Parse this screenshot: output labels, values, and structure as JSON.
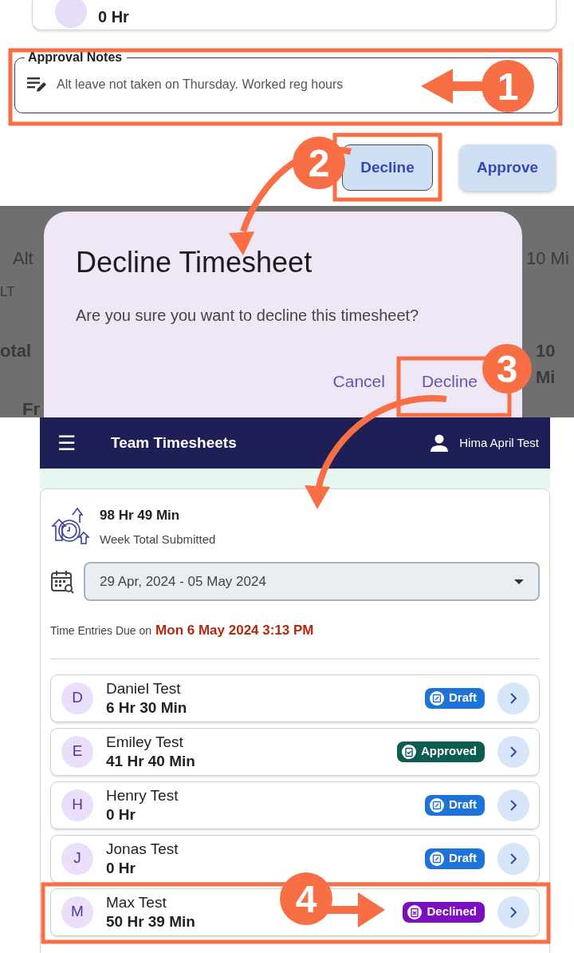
{
  "previous_card": {
    "hours": "0 Hr"
  },
  "approval_notes": {
    "label": "Approval Notes",
    "value": "Alt leave not taken on Thursday. Worked reg hours"
  },
  "review_buttons": [
    {
      "label": "Decline",
      "kind": "outlined"
    },
    {
      "label": "Approve",
      "kind": "raised"
    }
  ],
  "background_texts": [
    "Alt",
    "10 Mi",
    "LT",
    "otal",
    "10 Mi",
    "Fr"
  ],
  "dialog": {
    "title": "Decline Timesheet",
    "message": "Are you sure you want to decline this timesheet?",
    "buttons": [
      "Cancel",
      "Decline"
    ]
  },
  "app_bar": {
    "menu": "☰",
    "title": "Team Timesheets",
    "user": "Hima April Test"
  },
  "summary": {
    "total": "98 Hr 49 Min",
    "caption": "Week Total Submitted"
  },
  "week_select": {
    "value": "29 Apr, 2024 - 05 May 2024"
  },
  "due": {
    "label": "Time Entries Due on",
    "date": "Mon 6 May 2024 3:13 PM"
  },
  "employees": [
    {
      "initial": "D",
      "name": "Daniel Test",
      "hours": "6 Hr 30 Min",
      "status": "Draft",
      "kind": "draft"
    },
    {
      "initial": "E",
      "name": "Emiley Test",
      "hours": "41 Hr 40 Min",
      "status": "Approved",
      "kind": "approved"
    },
    {
      "initial": "H",
      "name": "Henry Test",
      "hours": "0 Hr",
      "status": "Draft",
      "kind": "draft"
    },
    {
      "initial": "J",
      "name": "Jonas Test",
      "hours": "0 Hr",
      "status": "Draft",
      "kind": "draft"
    },
    {
      "initial": "M",
      "name": "Max Test",
      "hours": "50 Hr 39 Min",
      "status": "Declined",
      "kind": "declined"
    }
  ],
  "steps": [
    "1",
    "2",
    "3",
    "4"
  ]
}
